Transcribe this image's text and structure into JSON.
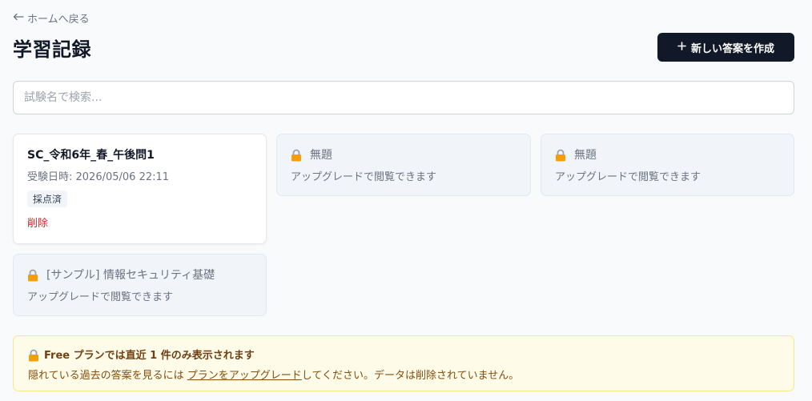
{
  "header": {
    "back_label": "ホームへ戻る",
    "title": "学習記録",
    "new_button_label": "新しい答案を作成"
  },
  "search": {
    "placeholder": "試験名で検索...",
    "value": ""
  },
  "records": [
    {
      "title": "SC_令和6年_春_午後問1",
      "date": "受験日時: 2026/05/06 22:11",
      "status": "採点済",
      "delete_label": "削除"
    }
  ],
  "locked_cards": [
    {
      "title": "無題",
      "subtitle": "アップグレードで閲覧できます"
    },
    {
      "title": "無題",
      "subtitle": "アップグレードで閲覧できます"
    },
    {
      "title": "[サンプル] 情報セキュリティ基礎",
      "subtitle": "アップグレードで閲覧できます"
    }
  ],
  "notice": {
    "title": "Free プランでは直近 1 件のみ表示されます",
    "text_before": "隠れている過去の答案を見るには ",
    "link": "プランをアップグレード",
    "text_after": "してください。データは削除されていません。"
  },
  "colors": {
    "primary_button": "#111827",
    "delete": "#dc2626",
    "notice_background": "#fefce8",
    "notice_border": "#fde68a"
  }
}
